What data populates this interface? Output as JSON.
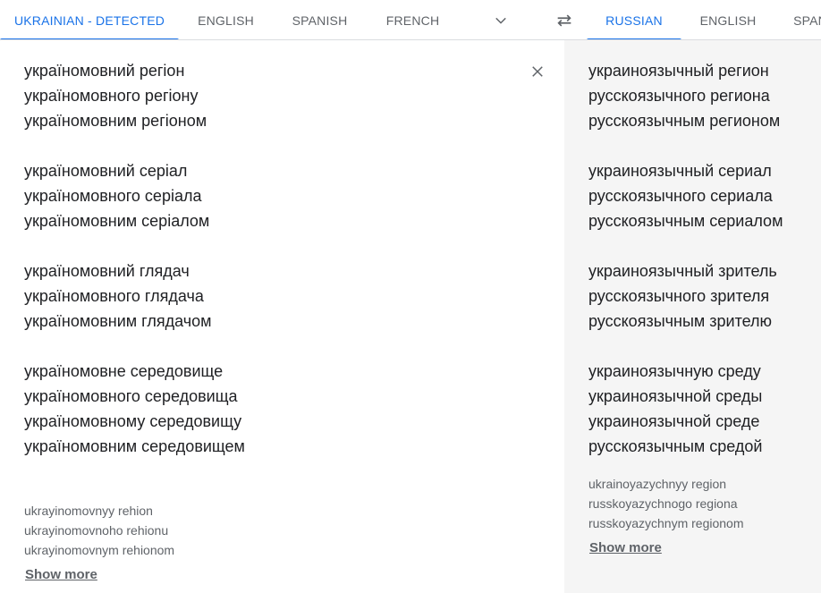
{
  "source_tabs": [
    {
      "label": "UKRAINIAN - DETECTED",
      "active": true
    },
    {
      "label": "ENGLISH",
      "active": false
    },
    {
      "label": "SPANISH",
      "active": false
    },
    {
      "label": "FRENCH",
      "active": false
    }
  ],
  "target_tabs": [
    {
      "label": "RUSSIAN",
      "active": true
    },
    {
      "label": "ENGLISH",
      "active": false
    },
    {
      "label": "SPANISH",
      "active": false
    }
  ],
  "icons": {
    "source_more": "chevron-down-icon",
    "swap": "swap-languages-icon",
    "clear": "close-icon"
  },
  "colors": {
    "accent": "#1a73e8",
    "tab_text": "#5f6368",
    "right_pane_bg": "#f5f5f5"
  },
  "source": {
    "text": "україномовний регіон\nукраїномовного регіону\nукраїномовним регіоном\n\nукраїномовний серіал\nукраїномовного серіала\nукраїномовним серіалом\n\nукраїномовний глядач\nукраїномовного глядача\nукраїномовним глядачом\n\nукраїномовне середовище\nукраїномовного середовища\nукраїномовному середовищу\nукраїномовним середовищем",
    "transliteration": "ukrayinomovnyy rehion\nukrayinomovnoho rehionu\nukrayinomovnym rehionom",
    "show_more": "Show more"
  },
  "target": {
    "text": "украиноязычный регион\nрусскоязычного региона\nрусскоязычным регионом\n\nукраиноязычный сериал\nрусскоязычного сериала\nрусскоязычным сериалом\n\nукраиноязычный зритель\nрусскоязычного зрителя\nрусскоязычным зрителю\n\nукраиноязычную среду\nукраиноязычной среды\nукраиноязычной среде\nрусскоязычным средой",
    "transliteration": "ukrainoyazychnyy region\nrusskoyazychnogo regiona\nrusskoyazychnym regionom",
    "show_more": "Show more"
  }
}
